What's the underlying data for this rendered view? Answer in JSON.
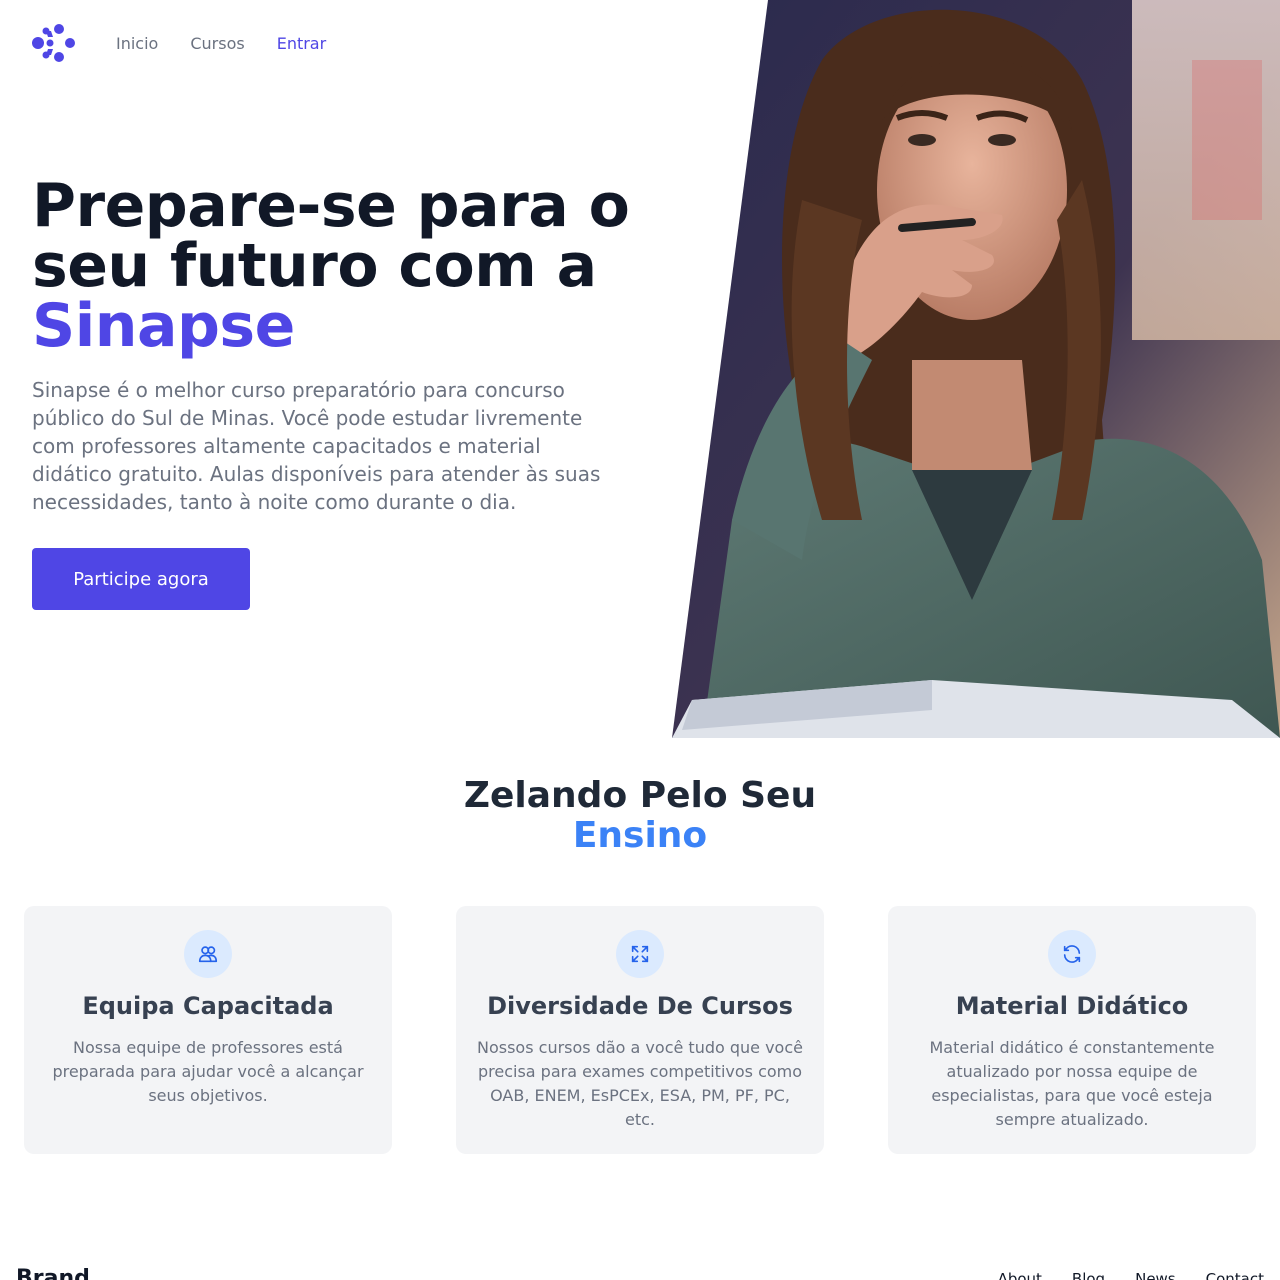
{
  "header": {
    "nav": [
      {
        "label": "Inicio",
        "active": false
      },
      {
        "label": "Cursos",
        "active": false
      },
      {
        "label": "Entrar",
        "active": true
      }
    ]
  },
  "hero": {
    "title_line1": "Prepare-se para o",
    "title_line2": "seu futuro com a",
    "title_accent": "Sinapse",
    "description": "Sinapse é o melhor curso preparatório para concurso público do Sul de Minas. Você pode estudar livremente com professores altamente capacitados e material didático gratuito. Aulas disponíveis para atender às suas necessidades, tanto à noite como durante o dia.",
    "cta_label": "Participe agora",
    "image_icon": "student-thinking-photo"
  },
  "features": {
    "title": "Zelando Pelo Seu",
    "title_accent": "Ensino",
    "cards": [
      {
        "icon": "users-icon",
        "title": "Equipa Capacitada",
        "text": "Nossa equipe de professores está preparada para ajudar você a alcançar seus objetivos."
      },
      {
        "icon": "expand-icon",
        "title": "Diversidade De Cursos",
        "text": "Nossos cursos dão a você tudo que você precisa para exames competitivos como OAB, ENEM, EsPCEx, ESA, PM, PF, PC, etc."
      },
      {
        "icon": "refresh-icon",
        "title": "Material Didático",
        "text": "Material didático é constantemente atualizado por nossa equipe de especialistas, para que você esteja sempre atualizado."
      }
    ]
  },
  "footer": {
    "brand": "Brand",
    "links": [
      "About",
      "Blog",
      "News",
      "Contact"
    ]
  },
  "colors": {
    "primary": "#4f46e5",
    "accent_blue": "#3b82f6",
    "card_bg": "#f3f4f6",
    "text_dark": "#111827",
    "text_muted": "#6b7280"
  }
}
